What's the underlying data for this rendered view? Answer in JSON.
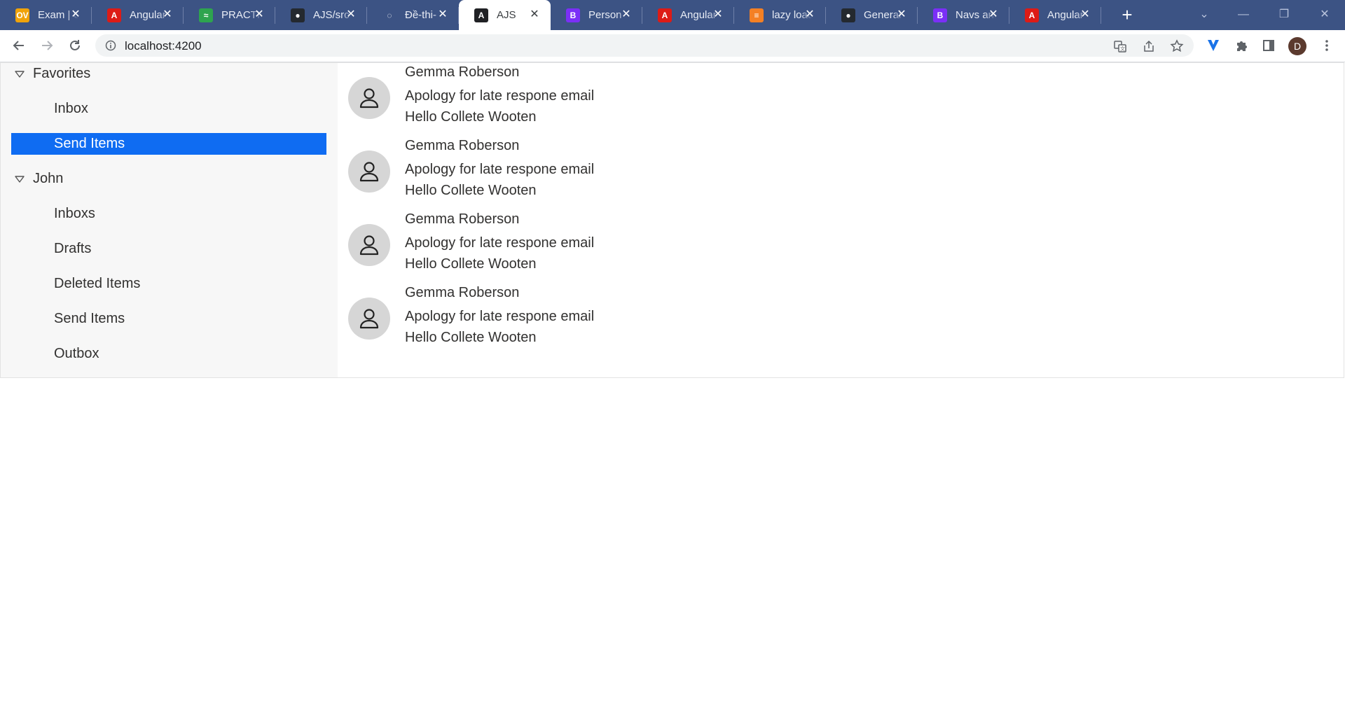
{
  "browser": {
    "tabs": [
      {
        "title": "Exam | O",
        "icon": "ov-icon",
        "color": "#f0a30a",
        "glyph": "OV"
      },
      {
        "title": "Angular",
        "icon": "angular-icon",
        "color": "#dd1b16",
        "glyph": "A"
      },
      {
        "title": "PRACTICE",
        "icon": "practice-icon",
        "color": "#2ea44f",
        "glyph": "≈"
      },
      {
        "title": "AJS/src",
        "icon": "github-icon",
        "color": "#24292f",
        "glyph": "●"
      },
      {
        "title": "Đề-thi-",
        "icon": "loading-icon",
        "color": "#3c5384",
        "glyph": "◌"
      },
      {
        "title": "AJS",
        "icon": "angular-black-icon",
        "color": "#202124",
        "glyph": "A",
        "active": true
      },
      {
        "title": "Person",
        "icon": "bootstrap-icon",
        "color": "#7b2ff7",
        "glyph": "B"
      },
      {
        "title": "Angular",
        "icon": "angular-icon",
        "color": "#dd1b16",
        "glyph": "A"
      },
      {
        "title": "lazy load",
        "icon": "stackoverflow-icon",
        "color": "#f48024",
        "glyph": "≡"
      },
      {
        "title": "General",
        "icon": "github-icon",
        "color": "#24292f",
        "glyph": "●"
      },
      {
        "title": "Navs and",
        "icon": "bootstrap-icon",
        "color": "#7b2ff7",
        "glyph": "B"
      },
      {
        "title": "Angular",
        "icon": "angular-icon",
        "color": "#dd1b16",
        "glyph": "A"
      }
    ],
    "url": "localhost:4200",
    "profile_initial": "D"
  },
  "sidebar": {
    "groups": [
      {
        "label": "Favorites",
        "items": [
          {
            "label": "Inbox",
            "selected": false
          },
          {
            "label": "Send Items",
            "selected": true
          }
        ]
      },
      {
        "label": "John",
        "items": [
          {
            "label": "Inboxs",
            "selected": false
          },
          {
            "label": "Drafts",
            "selected": false
          },
          {
            "label": "Deleted Items",
            "selected": false
          },
          {
            "label": "Send Items",
            "selected": false
          },
          {
            "label": "Outbox",
            "selected": false
          }
        ]
      }
    ],
    "selected_color": "#0f6cf2"
  },
  "mails": [
    {
      "from": "Gemma Roberson",
      "subject": "Apology for late respone email",
      "preview": "Hello Collete Wooten"
    },
    {
      "from": "Gemma Roberson",
      "subject": "Apology for late respone email",
      "preview": "Hello Collete Wooten"
    },
    {
      "from": "Gemma Roberson",
      "subject": "Apology for late respone email",
      "preview": "Hello Collete Wooten"
    },
    {
      "from": "Gemma Roberson",
      "subject": "Apology for late respone email",
      "preview": "Hello Collete Wooten"
    }
  ]
}
